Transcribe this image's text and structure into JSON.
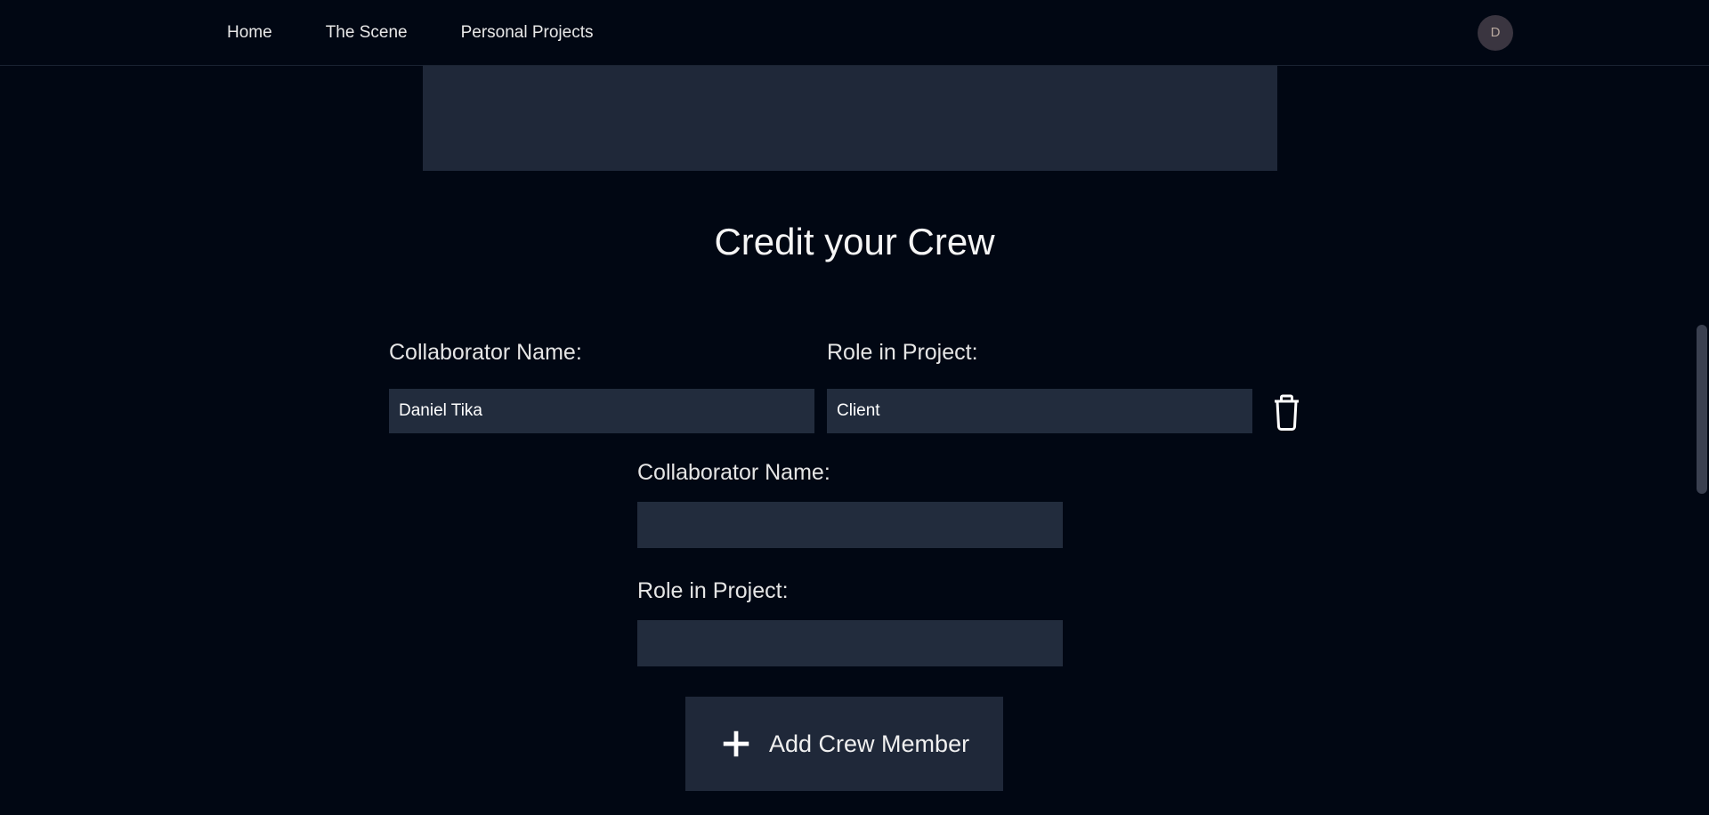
{
  "nav": {
    "links": [
      "Home",
      "The Scene",
      "Personal Projects"
    ],
    "avatar_initial": "D"
  },
  "section": {
    "title": "Credit your Crew"
  },
  "crew_row": {
    "name_label": "Collaborator Name:",
    "role_label": "Role in Project:",
    "name_value": "Daniel Tika",
    "role_value": "Client"
  },
  "new_crew": {
    "name_label": "Collaborator Name:",
    "name_value": "",
    "role_label": "Role in Project:",
    "role_value": ""
  },
  "add_button": {
    "label": "Add Crew Member"
  }
}
